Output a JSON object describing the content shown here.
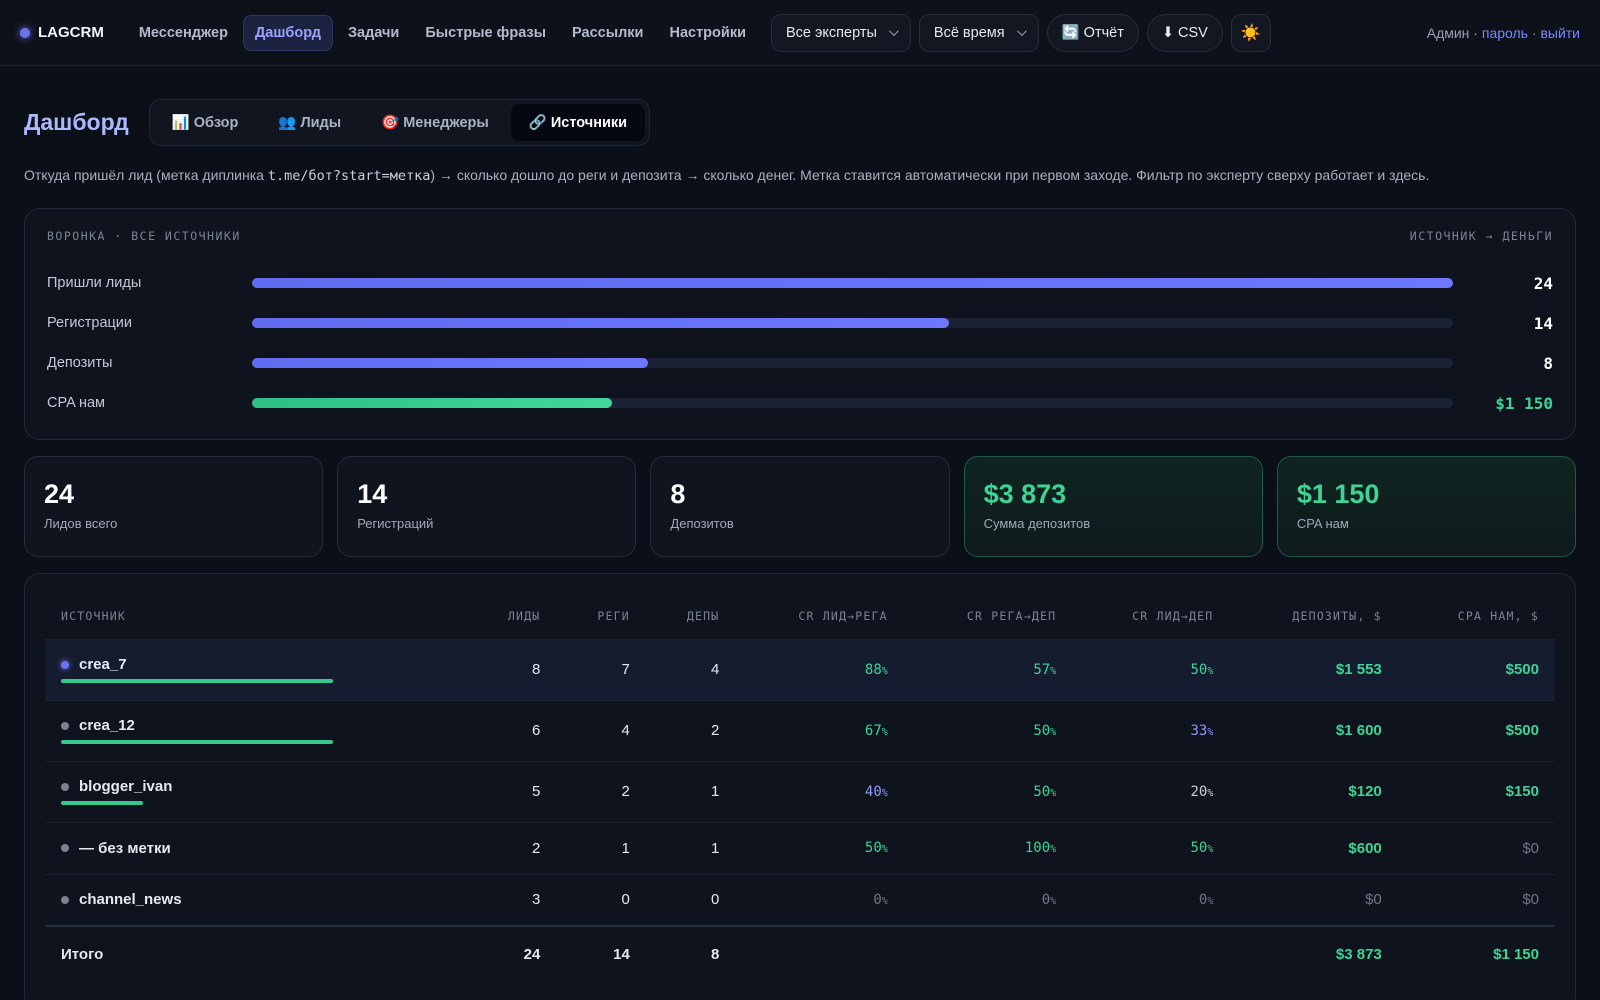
{
  "app": {
    "name": "LAGCRM"
  },
  "nav": [
    "Мессенджер",
    "Дашборд",
    "Задачи",
    "Быстрые фразы",
    "Рассылки",
    "Настройки"
  ],
  "controls": {
    "experts": "Все эксперты",
    "period": "Всё время",
    "report": "🔄 Отчёт",
    "csv": "⬇ CSV",
    "theme": "☀️"
  },
  "user": {
    "name": "Админ",
    "sep": " · ",
    "password": "пароль",
    "logout": "выйти"
  },
  "page": {
    "title": "Дашборд",
    "tabs": [
      "📊 Обзор",
      "👥 Лиды",
      "🎯 Менеджеры",
      "🔗 Источники"
    ],
    "desc_pre": "Откуда пришёл лид (метка диплинка ",
    "desc_code": "t.me/бот?start=метка",
    "desc_post": ") → сколько дошло до реги и депозита → сколько денег. Метка ставится автоматически при первом заходе. Фильтр по эксперту сверху работает и здесь."
  },
  "funnel": {
    "heading": "ВОРОНКА · ВСЕ ИСТОЧНИКИ",
    "heading_right": "ИСТОЧНИК → ДЕНЬГИ",
    "rows": [
      {
        "label": "Пришли лиды",
        "value": "24",
        "fraction": 1.0
      },
      {
        "label": "Регистрации",
        "value": "14",
        "fraction": 0.58
      },
      {
        "label": "Депозиты",
        "value": "8",
        "fraction": 0.33
      },
      {
        "label": "CPA нам",
        "value": "$1 150",
        "fraction": 0.3
      }
    ]
  },
  "stats": [
    {
      "value": "24",
      "label": "Лидов всего"
    },
    {
      "value": "14",
      "label": "Регистраций"
    },
    {
      "value": "8",
      "label": "Депозитов"
    },
    {
      "value": "$3 873",
      "label": "Сумма депозитов"
    },
    {
      "value": "$1 150",
      "label": "CPA нам"
    }
  ],
  "table": {
    "headers": [
      "ИСТОЧНИК",
      "ЛИДЫ",
      "РЕГИ",
      "ДЕПЫ",
      "CR ЛИД→РЕГА",
      "CR РЕГА→ДЕП",
      "CR ЛИД→ДЕП",
      "ДЕПОЗИТЫ, $",
      "CPA НАМ, $"
    ],
    "rows": [
      {
        "source": "crea_7",
        "leads": "8",
        "regs": "7",
        "deps": "4",
        "cr1": "88",
        "cr2": "57",
        "cr3": "50",
        "deposits": "$1 553",
        "cpa": "$500",
        "share": 0.33
      },
      {
        "source": "crea_12",
        "leads": "6",
        "regs": "4",
        "deps": "2",
        "cr1": "67",
        "cr2": "50",
        "cr3": "33",
        "deposits": "$1 600",
        "cpa": "$500",
        "share": 0.33
      },
      {
        "source": "blogger_ivan",
        "leads": "5",
        "regs": "2",
        "deps": "1",
        "cr1": "40",
        "cr2": "50",
        "cr3": "20",
        "deposits": "$120",
        "cpa": "$150",
        "share": 0.1
      },
      {
        "source": "— без метки",
        "leads": "2",
        "regs": "1",
        "deps": "1",
        "cr1": "50",
        "cr2": "100",
        "cr3": "50",
        "deposits": "$600",
        "cpa": "$0",
        "share": 0
      },
      {
        "source": "channel_news",
        "leads": "3",
        "regs": "0",
        "deps": "0",
        "cr1": "0",
        "cr2": "0",
        "cr3": "0",
        "deposits": "$0",
        "cpa": "$0",
        "share": 0
      }
    ],
    "total": {
      "label": "Итого",
      "leads": "24",
      "regs": "14",
      "deps": "8",
      "deposits": "$3 873",
      "cpa": "$1 150"
    },
    "pct_unit": "%"
  },
  "colors": {
    "accent": "#6b74f0",
    "green": "#3fd394",
    "blue": "#8e98ff"
  }
}
